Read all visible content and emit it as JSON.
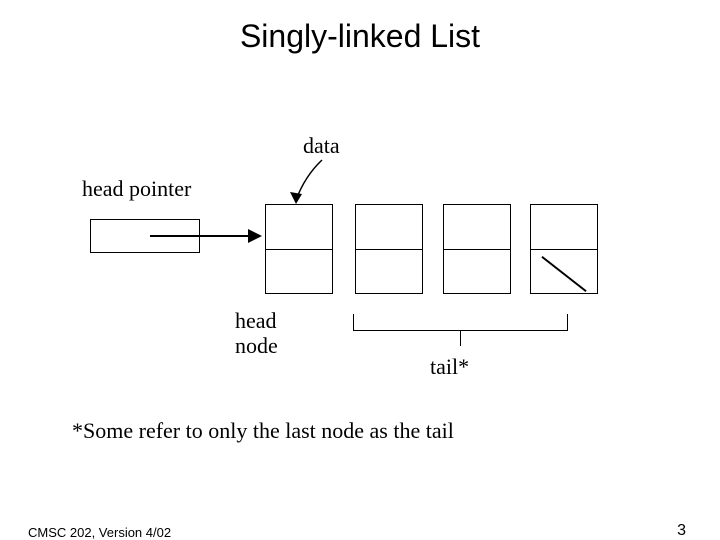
{
  "title": "Singly-linked List",
  "labels": {
    "data": "data",
    "head_pointer": "head pointer",
    "head_node": "head\nnode",
    "tail": "tail*"
  },
  "footnote": "*Some refer to only the last node as the tail",
  "footer": {
    "course": "CMSC 202, Version 4/02",
    "page": "3"
  },
  "diagram": {
    "description": "A singly-linked list: a head-pointer box with an arrow to the first of four nodes. Each node is split into a top data cell and a bottom pointer cell. The last node's pointer cell contains a diagonal slash indicating null. A curved arrow labeled 'data' points to the top (data) half of the first node. A bracket under the last three nodes is labeled 'tail*'.",
    "node_count": 4,
    "tail_bracket_spans_nodes": [
      2,
      3,
      4
    ]
  }
}
